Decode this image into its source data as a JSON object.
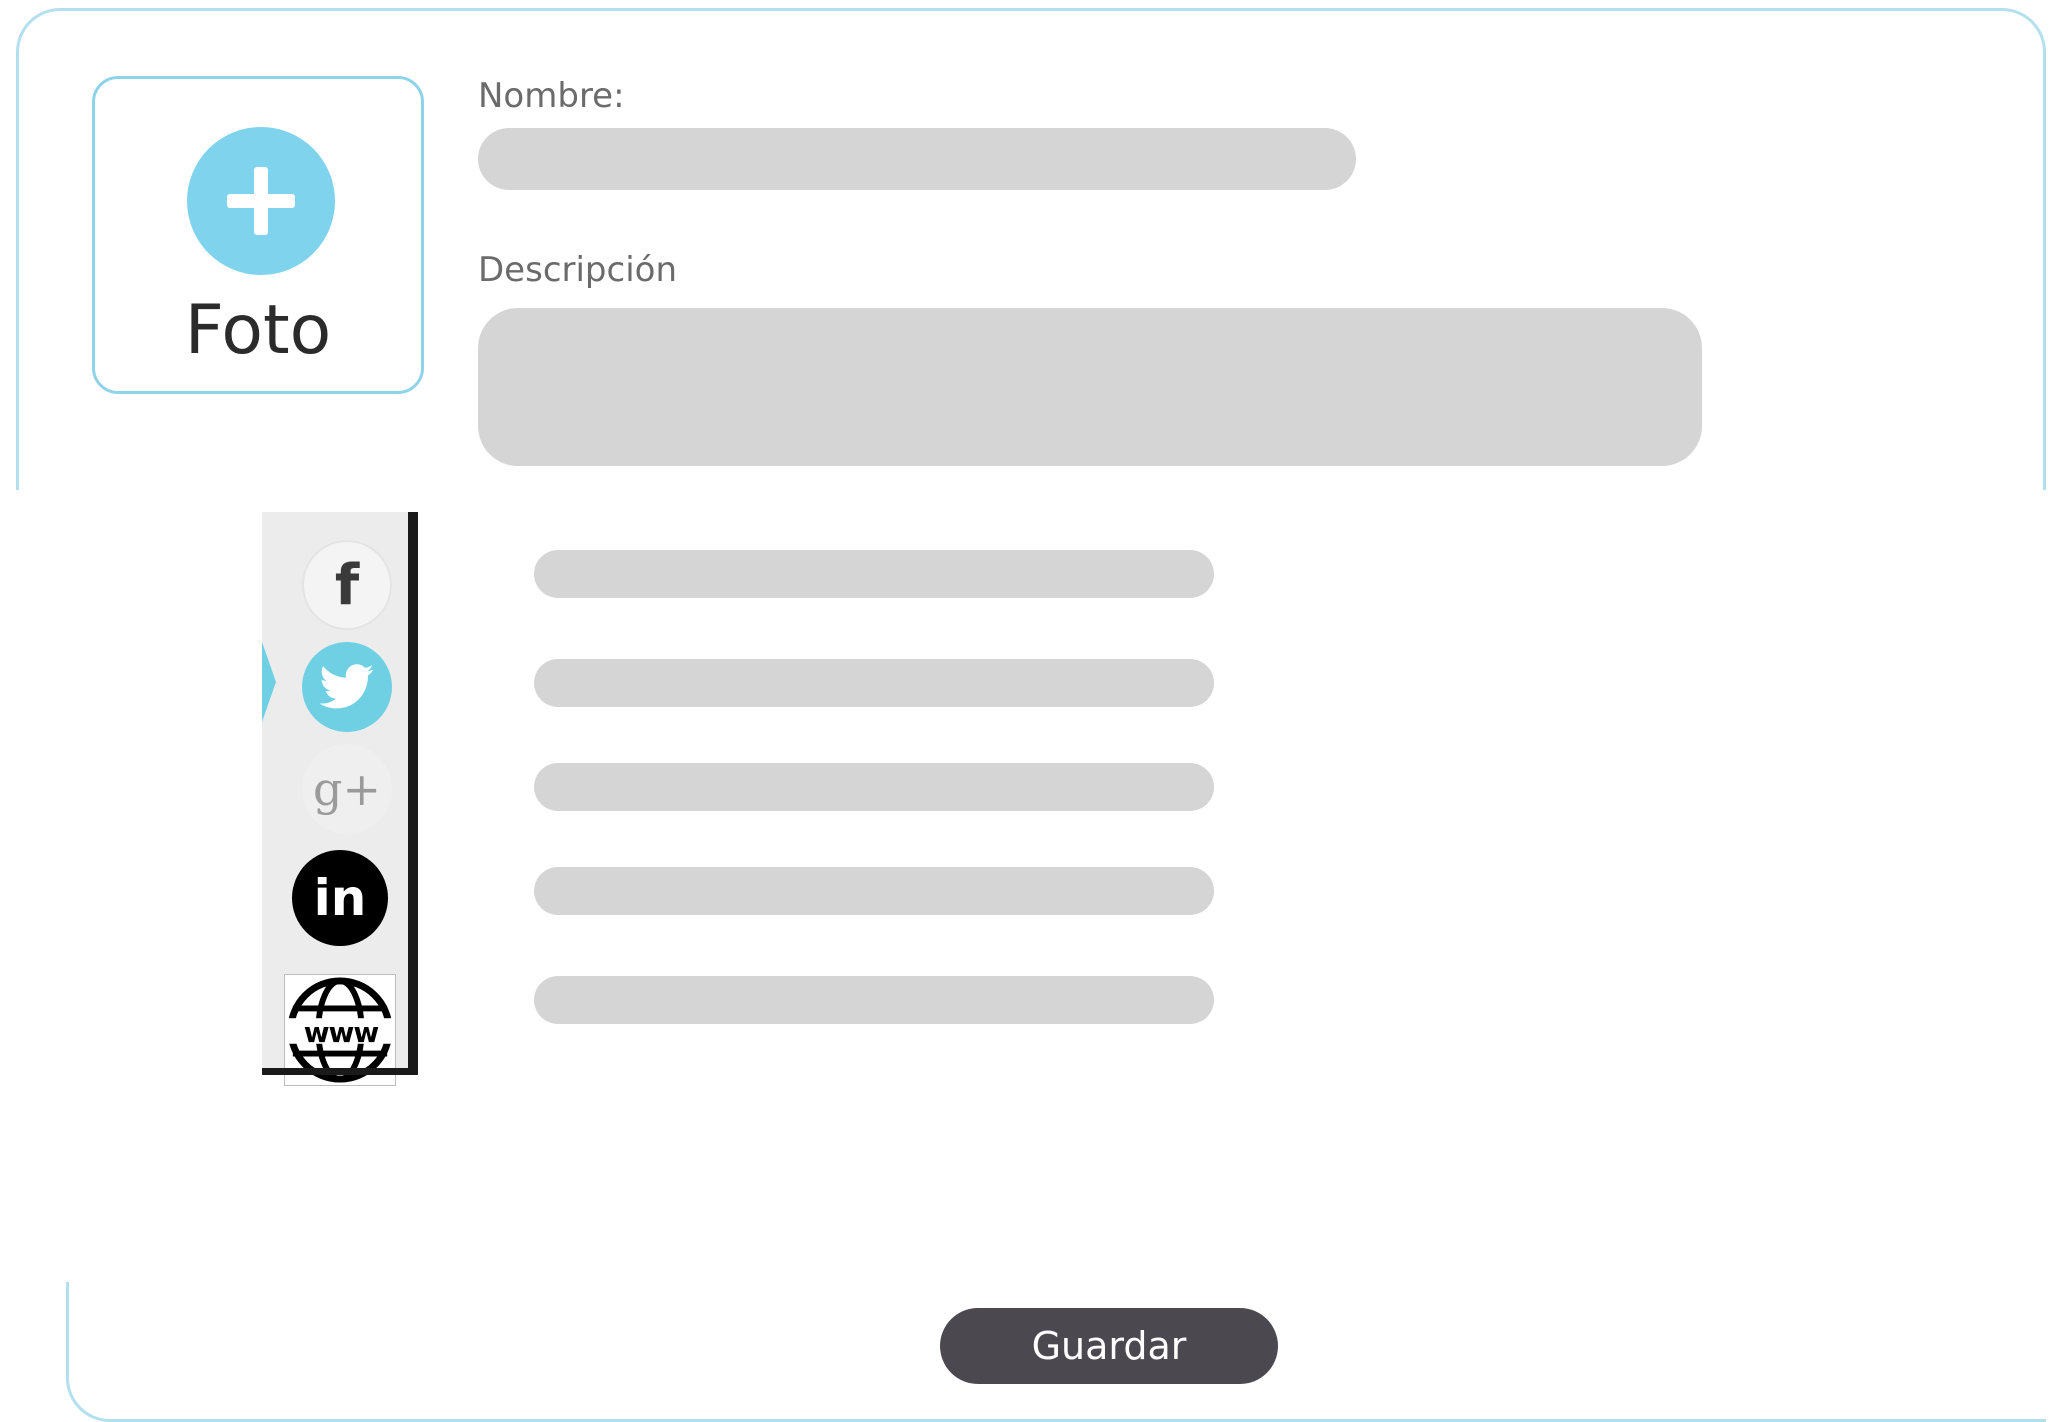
{
  "photo": {
    "label": "Foto",
    "icon": "plus-circle-icon"
  },
  "form": {
    "name_label": "Nombre:",
    "name_value": "",
    "description_label": "Descripción",
    "description_value": ""
  },
  "social": {
    "items": [
      {
        "icon": "facebook-icon",
        "glyph": "f",
        "value": ""
      },
      {
        "icon": "twitter-icon",
        "glyph": "",
        "value": ""
      },
      {
        "icon": "google-plus-icon",
        "glyph": "g+",
        "value": ""
      },
      {
        "icon": "linkedin-icon",
        "glyph": "in",
        "value": ""
      },
      {
        "icon": "website-icon",
        "glyph": "www",
        "value": ""
      }
    ]
  },
  "actions": {
    "save_label": "Guardar"
  },
  "colors": {
    "accent": "#7fd3ec",
    "frame": "#b3e0ee",
    "field": "#d5d5d5",
    "button": "#4b4850"
  }
}
